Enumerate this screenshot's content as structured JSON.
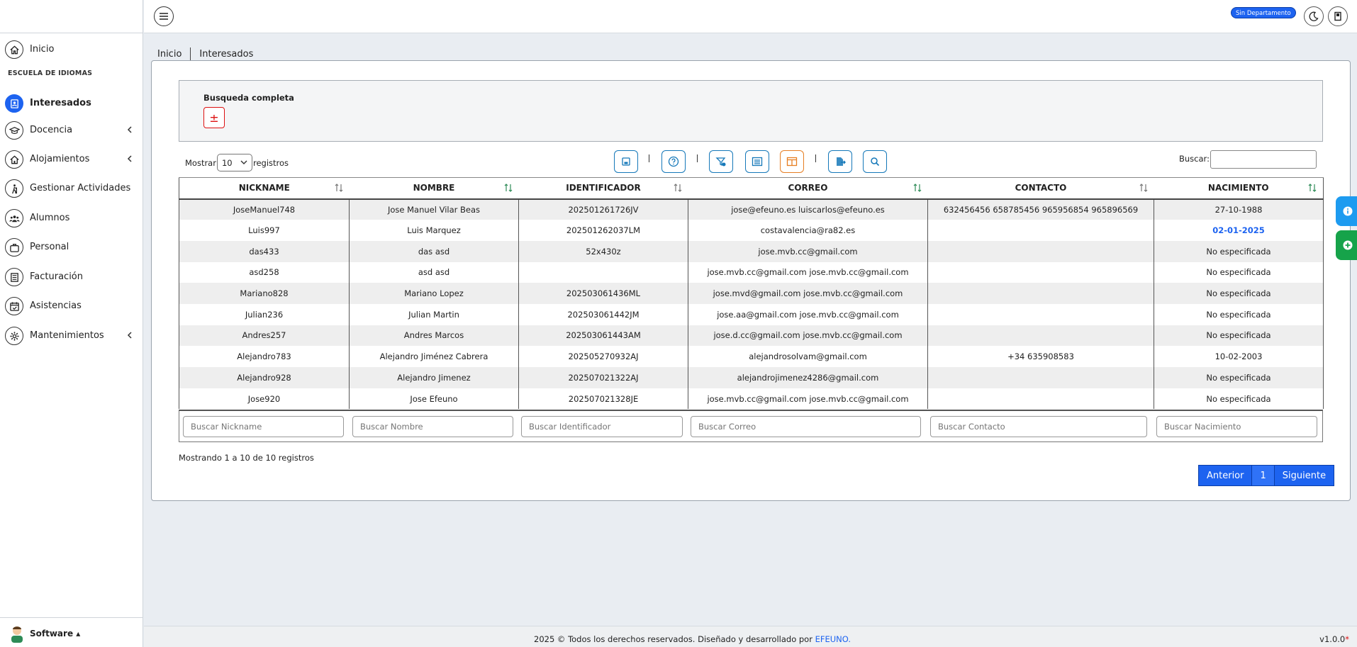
{
  "sidebar": {
    "items": [
      {
        "label": "Inicio",
        "icon": "home-icon"
      },
      {
        "label": "Interesados",
        "icon": "id-badge-icon",
        "active": true
      },
      {
        "label": "Docencia",
        "icon": "graduation-cap-icon"
      },
      {
        "label": "Alojamientos",
        "icon": "house-icon"
      },
      {
        "label": "Gestionar Actividades",
        "icon": "hiking-icon"
      },
      {
        "label": "Alumnos",
        "icon": "users-icon"
      },
      {
        "label": "Personal",
        "icon": "briefcase-icon"
      },
      {
        "label": "Facturación",
        "icon": "invoice-icon"
      },
      {
        "label": "Asistencias",
        "icon": "calendar-check-icon"
      },
      {
        "label": "Mantenimientos",
        "icon": "gear-icon"
      }
    ],
    "section": "ESCUELA DE IDIOMAS",
    "user": "Software"
  },
  "topbar": {
    "department": "Sin Departamento"
  },
  "breadcrumb": [
    "Inicio",
    "Interesados"
  ],
  "search_panel": {
    "title": "Busqueda completa",
    "toggle": "±"
  },
  "length": {
    "before": "Mostrar",
    "value": "10",
    "after": "registros"
  },
  "search": {
    "label": "Buscar:"
  },
  "table": {
    "headers": [
      "NICKNAME",
      "NOMBRE",
      "IDENTIFICADOR",
      "CORREO",
      "CONTACTO",
      "NACIMIENTO"
    ],
    "rows": [
      [
        "JoseManuel748",
        "Jose Manuel Vilar Beas",
        "202501261726JV",
        "jose@efeuno.es luiscarlos@efeuno.es",
        "632456456 658785456 965956854 965896569",
        "27-10-1988"
      ],
      [
        "Luis997",
        "Luis Marquez",
        "202501262037LM",
        "costavalencia@ra82.es",
        "",
        "02-01-2025"
      ],
      [
        "das433",
        "das asd",
        "52x430z",
        "jose.mvb.cc@gmail.com",
        "",
        "No especificada"
      ],
      [
        "asd258",
        "asd asd",
        "",
        "jose.mvb.cc@gmail.com jose.mvb.cc@gmail.com",
        "",
        "No especificada"
      ],
      [
        "Mariano828",
        "Mariano Lopez",
        "202503061436ML",
        "jose.mvd@gmail.com jose.mvb.cc@gmail.com",
        "",
        "No especificada"
      ],
      [
        "Julian236",
        "Julian Martin",
        "202503061442JM",
        "jose.aa@gmail.com jose.mvb.cc@gmail.com",
        "",
        "No especificada"
      ],
      [
        "Andres257",
        "Andres Marcos",
        "202503061443AM",
        "jose.d.cc@gmail.com jose.mvb.cc@gmail.com",
        "",
        "No especificada"
      ],
      [
        "Alejandro783",
        "Alejandro Jiménez Cabrera",
        "202505270932AJ",
        "alejandrosolvam@gmail.com",
        "+34 635908583",
        "10-02-2003"
      ],
      [
        "Alejandro928",
        "Alejandro Jimenez",
        "202507021322AJ",
        "alejandrojimenez4286@gmail.com",
        "",
        "No especificada"
      ],
      [
        "Jose920",
        "Jose Efeuno",
        "202507021328JE",
        "jose.mvb.cc@gmail.com jose.mvb.cc@gmail.com",
        "",
        "No especificada"
      ]
    ],
    "filters": [
      "Buscar Nickname",
      "Buscar Nombre",
      "Buscar Identificador",
      "Buscar Correo",
      "Buscar Contacto",
      "Buscar Nacimiento"
    ]
  },
  "info": "Mostrando 1 a 10 de 10 registros",
  "pagination": {
    "prev": "Anterior",
    "page": "1",
    "next": "Siguiente"
  },
  "footer": {
    "text": "2025 © Todos los derechos reservados. Diseñado y desarrollado por ",
    "link": "EFEUNO.",
    "version": "v1.0.0",
    "version_mark": "*"
  },
  "colors": {
    "accent": "#1d63f0",
    "danger": "#dd1111",
    "tool": "#1578b9",
    "tool_orange": "#e67e22",
    "side_tab_blue": "#1d9bf0",
    "side_tab_green": "#16a34a"
  }
}
